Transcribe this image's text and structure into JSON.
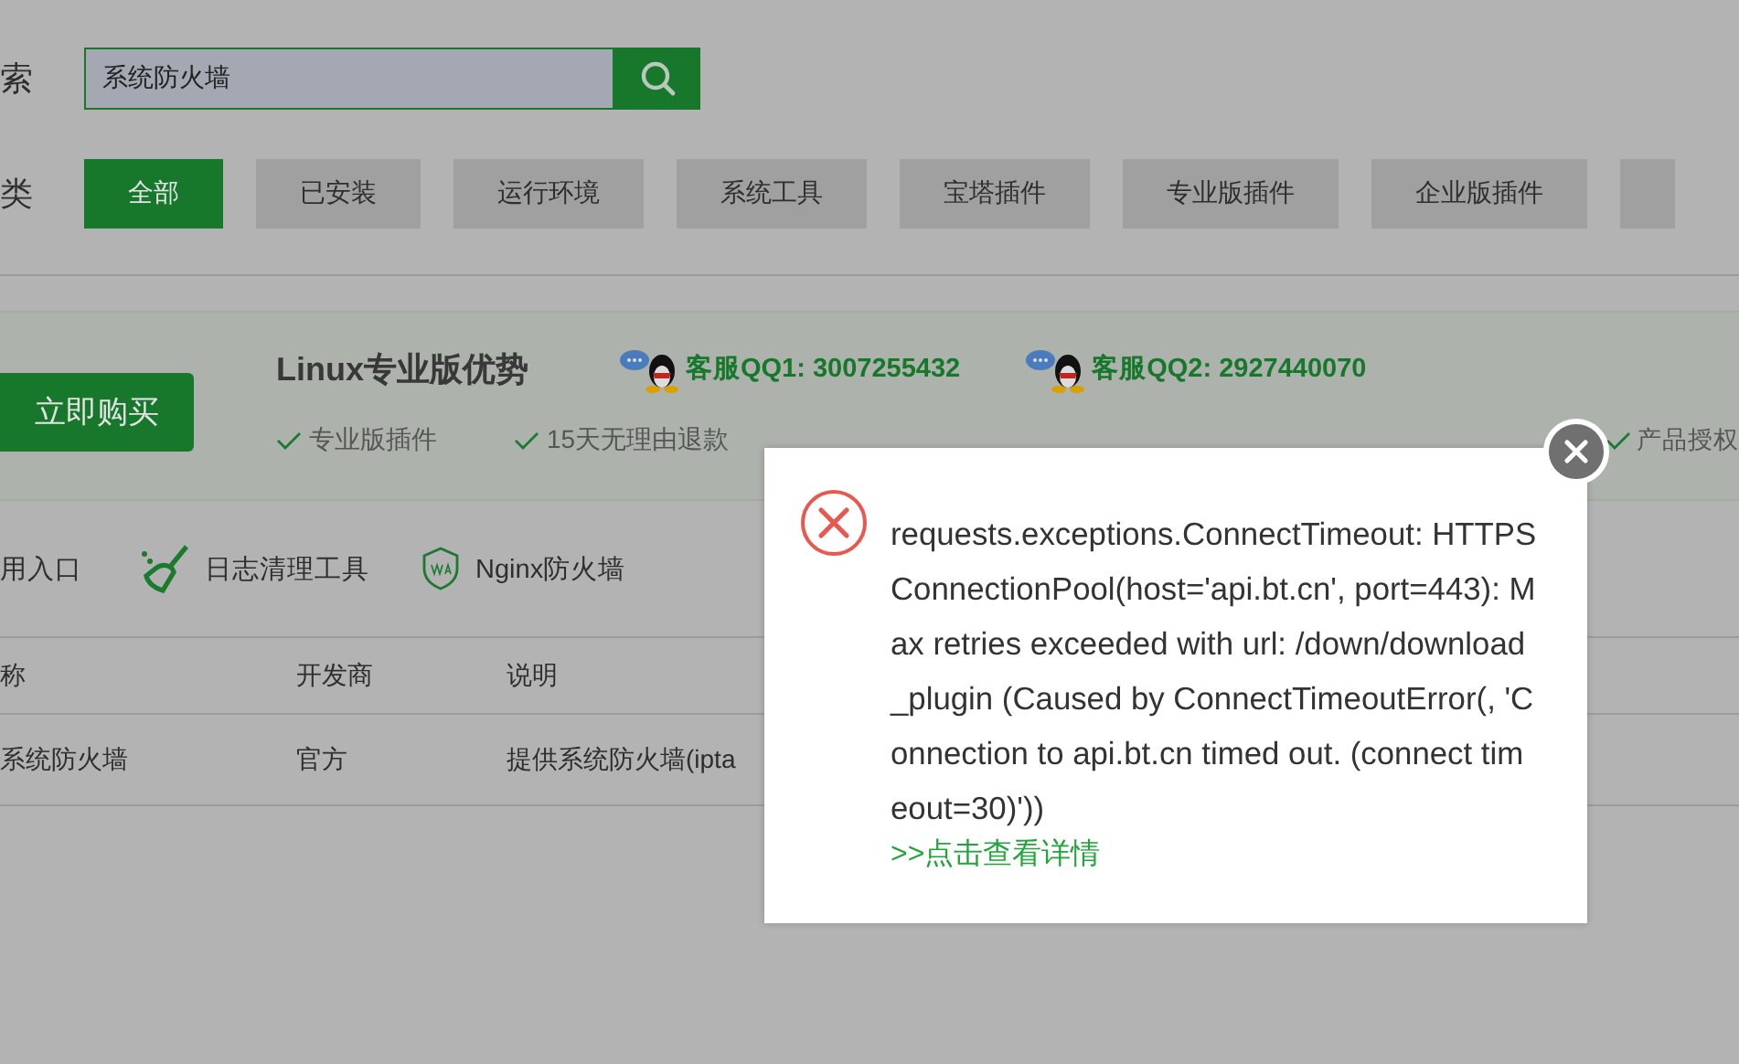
{
  "search": {
    "label": "索",
    "value": "系统防火墙"
  },
  "categories": {
    "label": "类",
    "tabs": [
      {
        "label": "全部",
        "selected": true
      },
      {
        "label": "已安装",
        "selected": false
      },
      {
        "label": "运行环境",
        "selected": false
      },
      {
        "label": "系统工具",
        "selected": false
      },
      {
        "label": "宝塔插件",
        "selected": false
      },
      {
        "label": "专业版插件",
        "selected": false
      },
      {
        "label": "企业版插件",
        "selected": false
      }
    ]
  },
  "promo": {
    "buy_button": "立即购买",
    "title": "Linux专业版优势",
    "contacts": [
      {
        "label": "客服QQ1: 3007255432"
      },
      {
        "label": "客服QQ2: 2927440070"
      }
    ],
    "features": [
      {
        "label": "专业版插件"
      },
      {
        "label": "15天无理由退款"
      },
      {
        "label": "产品授权"
      }
    ]
  },
  "tools": [
    {
      "kind": "text",
      "label": "用入口"
    },
    {
      "kind": "broom",
      "label": "日志清理工具"
    },
    {
      "kind": "waf",
      "label": "Nginx防火墙"
    }
  ],
  "table": {
    "columns": [
      "称",
      "开发商",
      "说明"
    ],
    "rows": [
      [
        "系统防火墙",
        "官方",
        "提供系统防火墙(ipta"
      ]
    ]
  },
  "dialog": {
    "message": "requests.exceptions.ConnectTimeout: HTTPSConnectionPool(host='api.bt.cn', port=443): Max retries exceeded with url: /down/download_plugin (Caused by ConnectTimeoutError(, 'Connection to api.bt.cn timed out. (connect timeout=30)'))",
    "link": ">>点击查看详情"
  }
}
